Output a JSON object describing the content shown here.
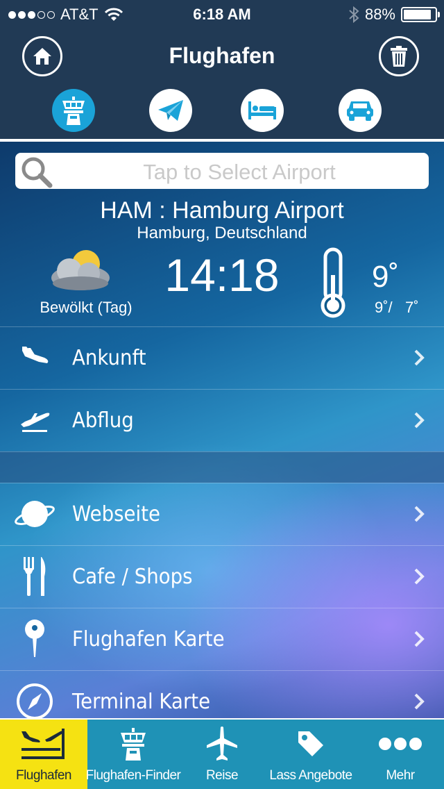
{
  "status_bar": {
    "carrier": "AT&T",
    "time": "6:18 AM",
    "battery": "88%",
    "battery_level": 0.88,
    "signal_bars_filled": 3,
    "signal_bars_total": 5
  },
  "header": {
    "title": "Flughafen",
    "home_icon": "home-icon",
    "trash_icon": "trash-icon",
    "tabs": [
      {
        "icon": "control-tower-icon",
        "active": true
      },
      {
        "icon": "paper-plane-icon",
        "active": false
      },
      {
        "icon": "bed-icon",
        "active": false
      },
      {
        "icon": "car-icon",
        "active": false
      }
    ]
  },
  "search": {
    "placeholder": "Tap to Select Airport"
  },
  "airport": {
    "name": "HAM : Hamburg Airport",
    "city": "Hamburg, Deutschland"
  },
  "weather": {
    "condition": "Bewölkt (Tag)",
    "local_time": "14:18",
    "temperature": "9˚",
    "high": "9˚/",
    "low": "7˚"
  },
  "menu": {
    "group1": [
      {
        "label": "Ankunft",
        "icon": "plane-landing-icon"
      },
      {
        "label": "Abflug",
        "icon": "plane-takeoff-icon"
      }
    ],
    "group2": [
      {
        "label": "Webseite",
        "icon": "planet-icon"
      },
      {
        "label": "Cafe / Shops",
        "icon": "fork-knife-icon"
      },
      {
        "label": "Flughafen Karte",
        "icon": "map-pin-icon"
      },
      {
        "label": "Terminal Karte",
        "icon": "compass-icon"
      }
    ]
  },
  "tab_bar": {
    "items": [
      {
        "label": "Flughafen",
        "icon": "airport-icon",
        "active": true
      },
      {
        "label": "Flughafen-Finder",
        "icon": "control-tower-icon",
        "active": false
      },
      {
        "label": "Reise",
        "icon": "airplane-icon",
        "active": false
      },
      {
        "label": "Lass Angebote",
        "icon": "price-tag-icon",
        "active": false
      },
      {
        "label": "Mehr",
        "icon": "more-icon",
        "active": false
      }
    ]
  },
  "colors": {
    "header_bg": "#213a55",
    "accent": "#1aa3d8",
    "tab_bar_bg": "#1f92b6",
    "active_tab_bg": "#f5e212"
  }
}
